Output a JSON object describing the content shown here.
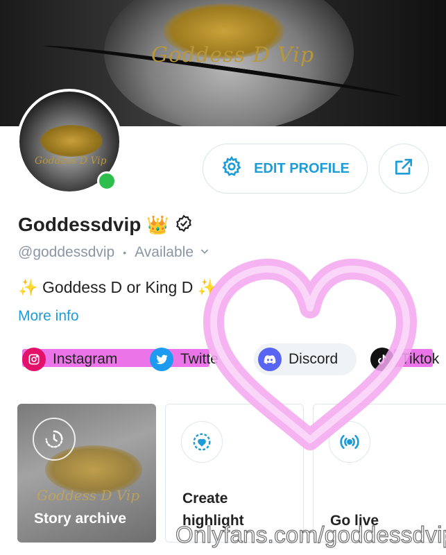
{
  "banner": {
    "watermark_text": "Goddess D Vip"
  },
  "avatar": {
    "watermark_text": "Goddess D Vip",
    "online": true
  },
  "actions": {
    "edit_profile_label": "EDIT PROFILE"
  },
  "profile": {
    "name": "Goddessdvip",
    "name_emoji": "👑",
    "handle": "@goddessdvip",
    "separator": "•",
    "status": "Available",
    "bio": "✨ Goddess D or King D ✨",
    "more_info": "More info"
  },
  "social": [
    {
      "label": "Instagram",
      "icon": "instagram-icon",
      "color": "#e4116a"
    },
    {
      "label": "Twitter",
      "icon": "twitter-icon",
      "color": "#1d9bf0"
    },
    {
      "label": "Discord",
      "icon": "discord-icon",
      "color": "#5865f2"
    },
    {
      "label": "Tiktok",
      "icon": "tiktok-icon",
      "color": "#111111"
    }
  ],
  "cards": {
    "archive": {
      "label": "Story archive",
      "watermark": "Goddess D Vip"
    },
    "highlight": {
      "line1": "Create",
      "line2": "highlight"
    },
    "live": {
      "label": "Go live"
    }
  },
  "overlay": {
    "watermark": "Onlyfans.com/goddessdvip",
    "heart_color": "#f4a6f0"
  },
  "colors": {
    "accent": "#1e9cd6",
    "online": "#2dbe4e",
    "highlight_bar": "#e85ce4"
  }
}
